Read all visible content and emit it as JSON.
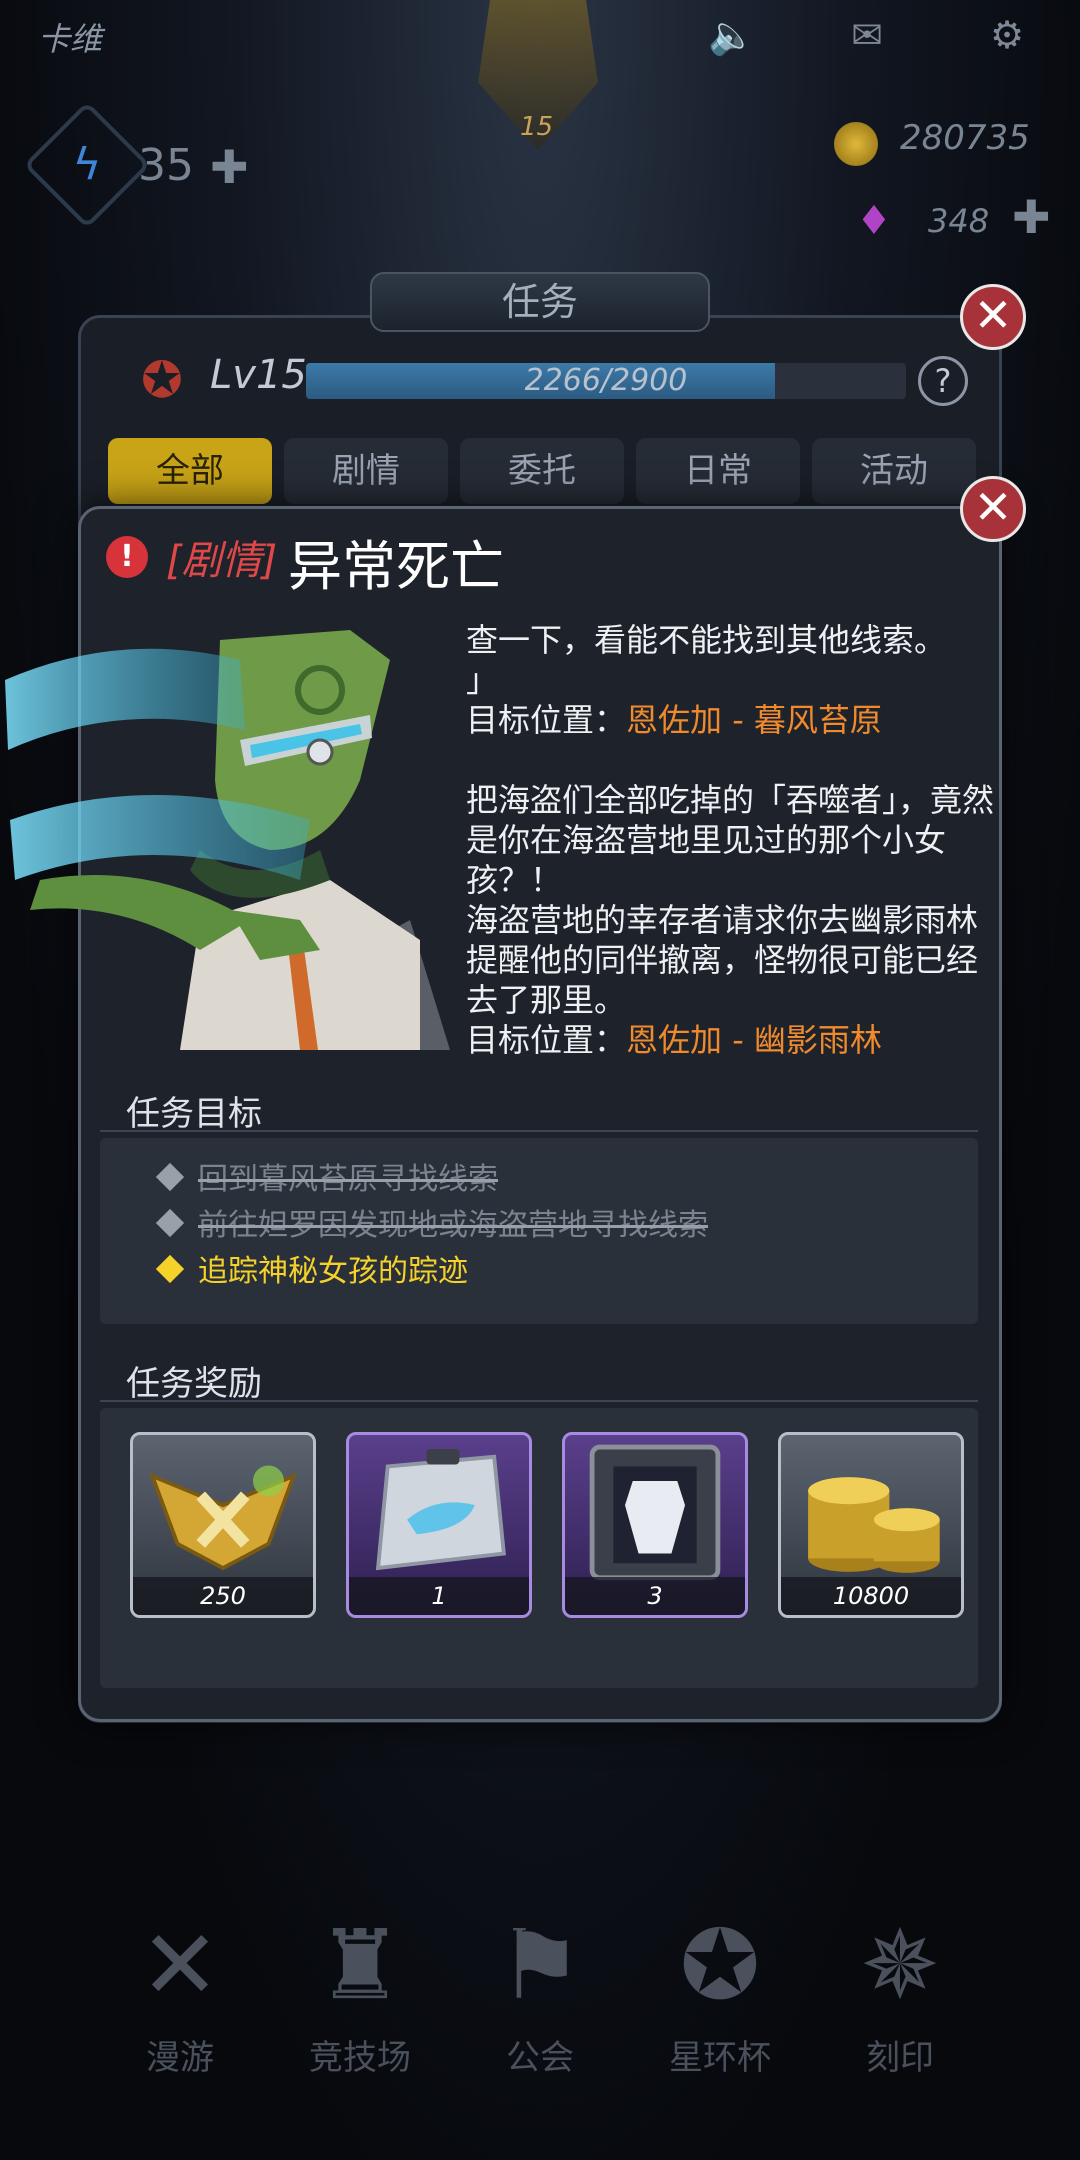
{
  "header": {
    "player_name": "卡维",
    "level_badge": "15",
    "energy": "35",
    "coins": "280735",
    "gems": "348"
  },
  "panel": {
    "title": "任务",
    "level_label": "Lv15",
    "xp_text": "2266/2900",
    "xp_progress": 0.781,
    "help_label": "?",
    "close_label": "✕",
    "tabs": [
      "全部",
      "剧情",
      "委托",
      "日常",
      "活动"
    ],
    "active_tab": "全部"
  },
  "quest": {
    "type_tag": "[剧情]",
    "title": "异常死亡",
    "description": {
      "para1_line": "查一下，看能不能找到其他线索。",
      "para1_end": "」",
      "location1_label": "目标位置：",
      "location1_value": "恩佐加 - 暮风苔原",
      "para2": "把海盗们全部吃掉的「吞噬者」，竟然是你在海盗营地里见过的那个小女孩？！",
      "para3": "海盗营地的幸存者请求你去幽影雨林提醒他的同伴撤离，怪物很可能已经去了那里。",
      "location2_label": "目标位置：",
      "location2_value": "恩佐加 - 幽影雨林"
    },
    "objectives_title": "任务目标",
    "objectives": [
      {
        "text": "回到暮风苔原寻找线索",
        "state": "done"
      },
      {
        "text": "前往妲罗因发现地或海盗营地寻找线索",
        "state": "done"
      },
      {
        "text": "追踪神秘女孩的踪迹",
        "state": "current"
      }
    ],
    "rewards_title": "任务奖励",
    "rewards": [
      {
        "icon": "rank-xp-icon",
        "count": "250",
        "rarity": "common"
      },
      {
        "icon": "blueprint-card-icon",
        "count": "1",
        "rarity": "epic"
      },
      {
        "icon": "armor-crate-icon",
        "count": "3",
        "rarity": "epic"
      },
      {
        "icon": "gold-coins-icon",
        "count": "10800",
        "rarity": "common"
      }
    ]
  },
  "bottom_nav": [
    "漫游",
    "竞技场",
    "公会",
    "星环杯",
    "刻印"
  ],
  "colors": {
    "accent_gold": "#c9a417",
    "story_red": "#e04848",
    "location_orange": "#f08a2c",
    "current_objective": "#f5d22a",
    "epic_purple": "#a78be0"
  }
}
